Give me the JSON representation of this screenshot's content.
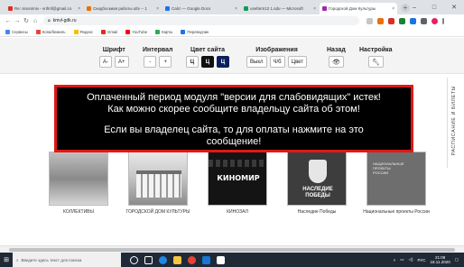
{
  "browser": {
    "tabs": [
      {
        "title": "Re: sinonimiv - vnfmf@gmail.co",
        "color": "#d93025",
        "active": false
      },
      {
        "title": "Скидбоскиая работы ultv -- 1",
        "color": "#e37400",
        "active": false
      },
      {
        "title": "Calc! — Google Docs",
        "color": "#1a73e8",
        "active": false
      },
      {
        "title": "usefarm12 1.sdu — Microsoft",
        "color": "#0f9d58",
        "active": false
      },
      {
        "title": "Городской Дом Культуры",
        "color": "#9c27b0",
        "active": true
      }
    ],
    "url": "kmvl-gdk.ru",
    "bookmarks": [
      {
        "label": "Сервисы",
        "color": "#4285f4"
      },
      {
        "label": "Копа/бемиль",
        "color": "#ea4335"
      },
      {
        "label": "Яндекс",
        "color": "#fbbc05"
      },
      {
        "label": "Gmail",
        "color": "#d93025"
      },
      {
        "label": "YouTube",
        "color": "#ff0000"
      },
      {
        "label": "Карты",
        "color": "#34a853"
      },
      {
        "label": "Переводчик",
        "color": "#1a73e8"
      }
    ]
  },
  "toolbar": {
    "font": {
      "label": "Шрифт",
      "dec": "A-",
      "inc": "A+"
    },
    "spacing": {
      "label": "Интервал",
      "dec": "-",
      "inc": "+"
    },
    "color": {
      "label": "Цвет сайта",
      "opt1": "Ц",
      "opt2": "Ц",
      "opt3": "Ц"
    },
    "images": {
      "label": "Изображения",
      "off": "Выкл",
      "bw": "Ч/б",
      "col": "Цвет"
    },
    "back": {
      "label": "Назад"
    },
    "settings": {
      "label": "Настройка"
    }
  },
  "warning": {
    "line1": "Оплаченный период модуля \"версии для слабовидящих\" истек!",
    "line2": "Как можно скорее сообщите владельцу сайта об этом!",
    "line3": "Если вы владелец сайта, то для оплаты нажмите на это",
    "line4": "сообщение!"
  },
  "cards": [
    {
      "caption": "КОЛЛЕКТИВЫ"
    },
    {
      "caption": "ГОРОДСКОЙ ДОМ КУЛЬТУРЫ"
    },
    {
      "caption": "КИНОЗАЛ",
      "thumb_text": "КИНОМИР"
    },
    {
      "caption": "Наследие Победы",
      "thumb_text": "НАСЛЕДИЕ ПОБЕДЫ"
    },
    {
      "caption": "Национальные проекты России",
      "thumb_text": "НАЦИОНАЛЬНЫЕ ПРОЕКТЫ РОССИИ"
    }
  ],
  "sidebar": {
    "vertical_label": "РАСПИСАНИЕ И БИЛЕТЫ"
  },
  "taskbar": {
    "search_placeholder": "Введите здесь текст для поиска",
    "lang": "РУС",
    "time": "21:08",
    "date": "18.11.2020"
  },
  "colors": {
    "banner_border": "#e01818",
    "banner_bg": "#000000",
    "accent_navy": "#0b1f5c"
  }
}
